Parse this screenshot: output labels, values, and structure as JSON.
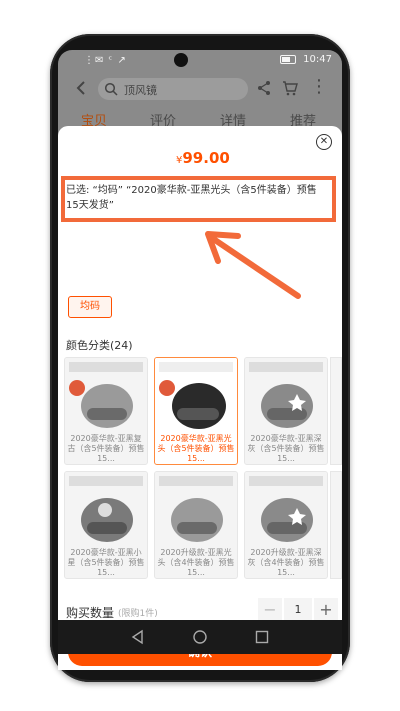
{
  "status_bar": {
    "left": "⋮✉ ᶜ ↗",
    "time": "10:47"
  },
  "search": {
    "placeholder": "顶风镜"
  },
  "tabs": [
    {
      "label": "宝贝"
    },
    {
      "label": "评价"
    },
    {
      "label": "详情"
    },
    {
      "label": "推荐"
    }
  ],
  "sheet": {
    "price_symbol": "¥",
    "price_value": "99.00",
    "selected_text": "已选: “均码” “2020豪华款-亚黑光头（含5件装备）预售15天发货”",
    "size_chip": "均码",
    "color_section_title": "颜色分类(24)",
    "cards": [
      {
        "caption": "2020豪华款-亚黑复古（含5件装备）预售15..."
      },
      {
        "caption": "2020豪华款-亚黑光头（含5件装备）预售15..."
      },
      {
        "caption": "2020豪华款-亚黑深灰（含5件装备）预售15..."
      },
      {
        "caption": "2020豪华款-亚黑小星（含5件装备）预售15..."
      },
      {
        "caption": "2020升级款-亚黑光头（含4件装备）预售15..."
      },
      {
        "caption": "2020升级款-亚黑深灰（含4件装备）预售15..."
      }
    ],
    "qty_label": "购买数量",
    "qty_note": "(限购1件)",
    "qty_minus": "−",
    "qty_value": "1",
    "qty_plus": "+",
    "confirm_label": "确认"
  },
  "colors": {
    "accent": "#ff5000",
    "highlight": "#f26a3a"
  }
}
